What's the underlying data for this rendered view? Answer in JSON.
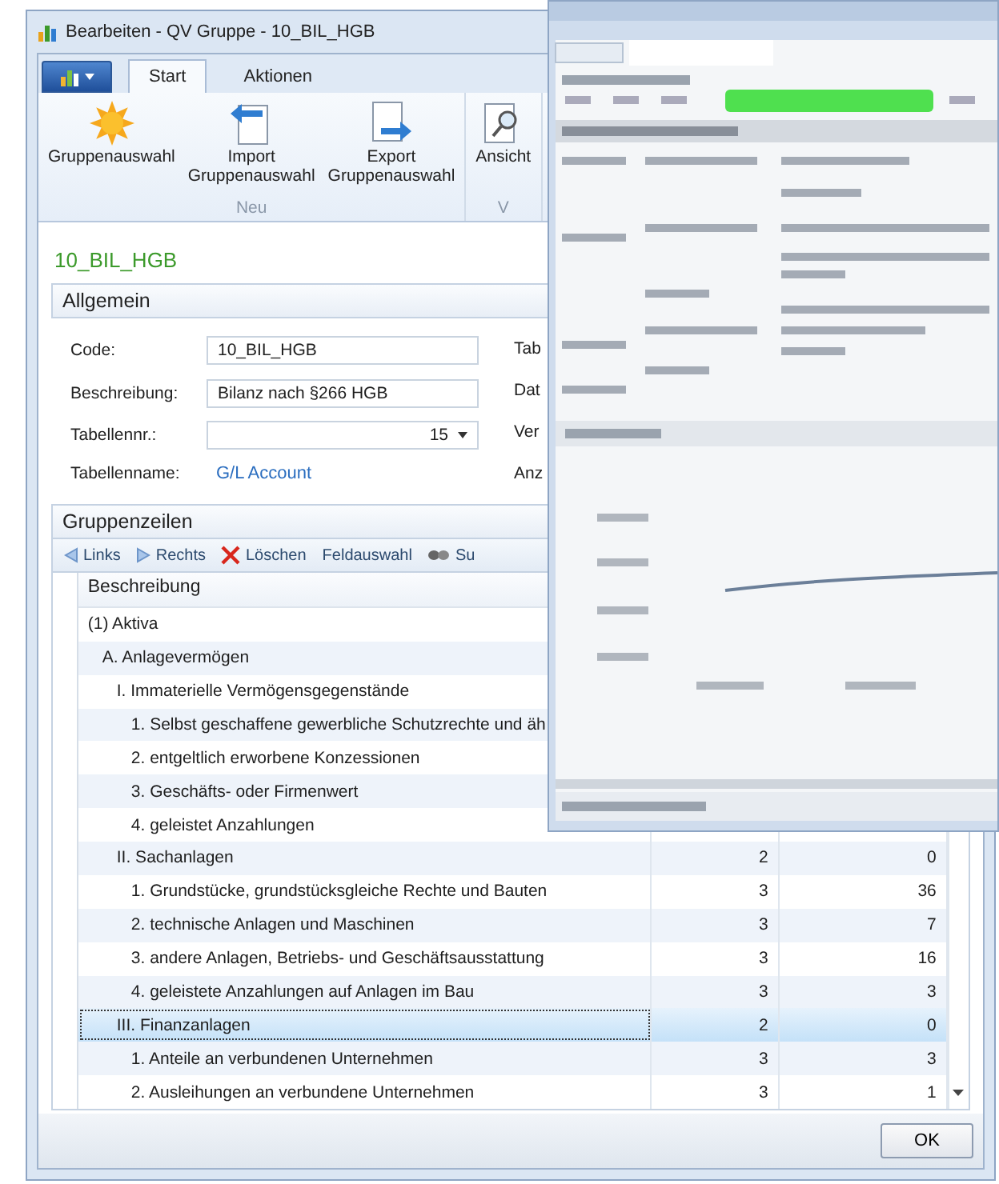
{
  "window": {
    "title": "Bearbeiten - QV Gruppe - 10_BIL_HGB"
  },
  "ribbon": {
    "tabs": [
      {
        "label": "Start",
        "selected": true
      },
      {
        "label": "Aktionen",
        "selected": false
      }
    ],
    "groups": [
      {
        "label": "Neu",
        "buttons": [
          {
            "kind": "sun",
            "lines": [
              "Gruppenauswahl"
            ]
          },
          {
            "kind": "import",
            "lines": [
              "Import",
              "Gruppenauswahl"
            ]
          },
          {
            "kind": "export",
            "lines": [
              "Export",
              "Gruppenauswahl"
            ]
          }
        ]
      },
      {
        "label": "V",
        "buttons": [
          {
            "kind": "view",
            "lines": [
              "Ansicht"
            ]
          }
        ]
      }
    ]
  },
  "page_title": "10_BIL_HGB",
  "general": {
    "title": "Allgemein",
    "fields": [
      {
        "kind": "text",
        "label": "Code:",
        "value": "10_BIL_HGB"
      },
      {
        "kind": "text",
        "label": "Beschreibung:",
        "value": "Bilanz nach §266 HGB"
      },
      {
        "kind": "dropdown",
        "label": "Tabellennr.:",
        "value": "15"
      },
      {
        "kind": "link",
        "label": "Tabellenname:",
        "value": "G/L Account"
      }
    ],
    "right_labels": [
      "Tab",
      "Dat",
      "Ver",
      "Anz"
    ]
  },
  "lines": {
    "title": "Gruppenzeilen",
    "toolbar": [
      {
        "kind": "left",
        "label": "Links"
      },
      {
        "kind": "right",
        "label": "Rechts"
      },
      {
        "kind": "delete",
        "label": "Löschen"
      },
      {
        "kind": "plain",
        "label": "Feldauswahl"
      },
      {
        "kind": "eye",
        "label": "Su"
      }
    ],
    "columns": [
      "Beschreibung"
    ],
    "rows": [
      {
        "label": "(1) Aktiva",
        "selected": false,
        "children": [
          {
            "label": "A. Anlagevermögen",
            "selected": false,
            "children": [
              {
                "label": "I. Immaterielle Vermögensgegenstände",
                "selected": false,
                "children": [
                  {
                    "label": "1. Selbst geschaffene gewerbliche Schutzrechte und äh",
                    "selected": false
                  },
                  {
                    "label": "2. entgeltlich erworbene Konzessionen",
                    "selected": false
                  },
                  {
                    "label": "3. Geschäfts- oder Firmenwert",
                    "selected": false
                  },
                  {
                    "label": "4. geleistet Anzahlungen",
                    "selected": false
                  }
                ]
              },
              {
                "label": "II. Sachanlagen",
                "selected": false,
                "column_2": "2",
                "column_3": "0",
                "children": [
                  {
                    "label": "1. Grundstücke, grundstücksgleiche Rechte und Bauten",
                    "selected": false,
                    "column_2": "3",
                    "column_3": "36"
                  },
                  {
                    "label": "2. technische Anlagen und Maschinen",
                    "selected": false,
                    "column_2": "3",
                    "column_3": "7"
                  },
                  {
                    "label": "3. andere Anlagen, Betriebs- und Geschäftsausstattung",
                    "selected": false,
                    "column_2": "3",
                    "column_3": "16"
                  },
                  {
                    "label": "4. geleistete Anzahlungen auf Anlagen im Bau",
                    "selected": false,
                    "column_2": "3",
                    "column_3": "3"
                  }
                ]
              },
              {
                "label": "III. Finanzanlagen",
                "selected": true,
                "column_2": "2",
                "column_3": "0",
                "children": [
                  {
                    "label": "1. Anteile an verbundenen Unternehmen",
                    "selected": false,
                    "column_2": "3",
                    "column_3": "3"
                  },
                  {
                    "label": "2. Ausleihungen an verbundene Unternehmen",
                    "selected": false,
                    "column_2": "3",
                    "column_3": "1"
                  }
                ]
              }
            ]
          }
        ]
      }
    ]
  },
  "buttons": [
    "OK"
  ]
}
